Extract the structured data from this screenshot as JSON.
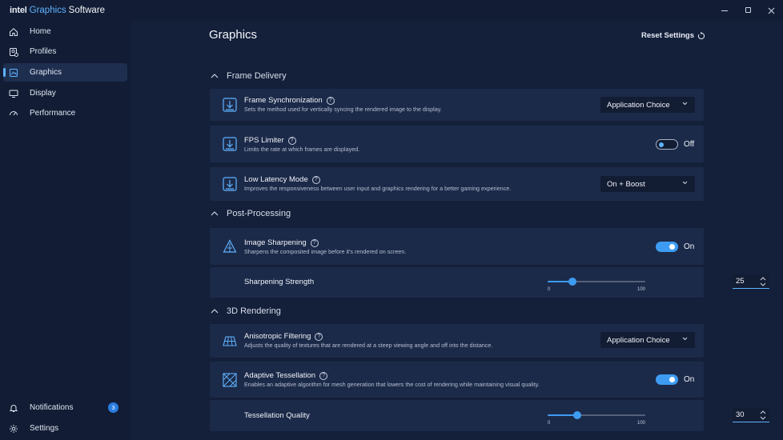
{
  "app": {
    "brand": "intel",
    "name_accent": "Graphics",
    "name_rest": "Software",
    "accent_color": "#5fb3ff",
    "window_controls": [
      "minimize",
      "restore",
      "close"
    ]
  },
  "sidebar": {
    "items": [
      {
        "label": "Home",
        "icon": "home-icon",
        "active": false
      },
      {
        "label": "Profiles",
        "icon": "profiles-icon",
        "active": false
      },
      {
        "label": "Graphics",
        "icon": "graphics-icon",
        "active": true
      },
      {
        "label": "Display",
        "icon": "display-icon",
        "active": false
      },
      {
        "label": "Performance",
        "icon": "performance-icon",
        "active": false
      }
    ],
    "bottom": [
      {
        "label": "Notifications",
        "icon": "bell-icon",
        "badge": "3"
      },
      {
        "label": "Settings",
        "icon": "gear-icon"
      }
    ]
  },
  "page": {
    "title": "Graphics",
    "reset_label": "Reset Settings"
  },
  "sections": [
    {
      "title": "Frame Delivery",
      "expanded": true
    },
    {
      "title": "Post-Processing",
      "expanded": true
    },
    {
      "title": "3D Rendering",
      "expanded": true
    }
  ],
  "settings": {
    "frame_sync": {
      "label": "Frame Synchronization",
      "desc": "Sets the method used for vertically syncing the rendered image to the display.",
      "value": "Application Choice"
    },
    "fps_limiter": {
      "label": "FPS Limiter",
      "desc": "Limits the rate at which frames are displayed.",
      "state": "Off"
    },
    "low_latency": {
      "label": "Low Latency Mode",
      "desc": "Improves the responsiveness between user input and graphics rendering for a better gaming experience.",
      "value": "On + Boost"
    },
    "image_sharpening": {
      "label": "Image Sharpening",
      "desc": "Sharpens the composited image before it's rendered on screen.",
      "state": "On"
    },
    "sharpening_strength": {
      "label": "Sharpening Strength",
      "value": "25",
      "min": "0",
      "max": "100",
      "fraction": 0.25
    },
    "anisotropic": {
      "label": "Anisotropic Filtering",
      "desc": "Adjusts the quality of textures that are rendered at a steep viewing angle and off into the distance.",
      "value": "Application Choice"
    },
    "adaptive_tess": {
      "label": "Adaptive Tessellation",
      "desc": "Enables an adaptive algorithm for mesh generation that lowers the cost of rendering while maintaining visual quality.",
      "state": "On"
    },
    "tess_quality": {
      "label": "Tessellation Quality",
      "value": "30",
      "min": "0",
      "max": "100",
      "fraction": 0.3
    }
  },
  "help_glyph": "?"
}
